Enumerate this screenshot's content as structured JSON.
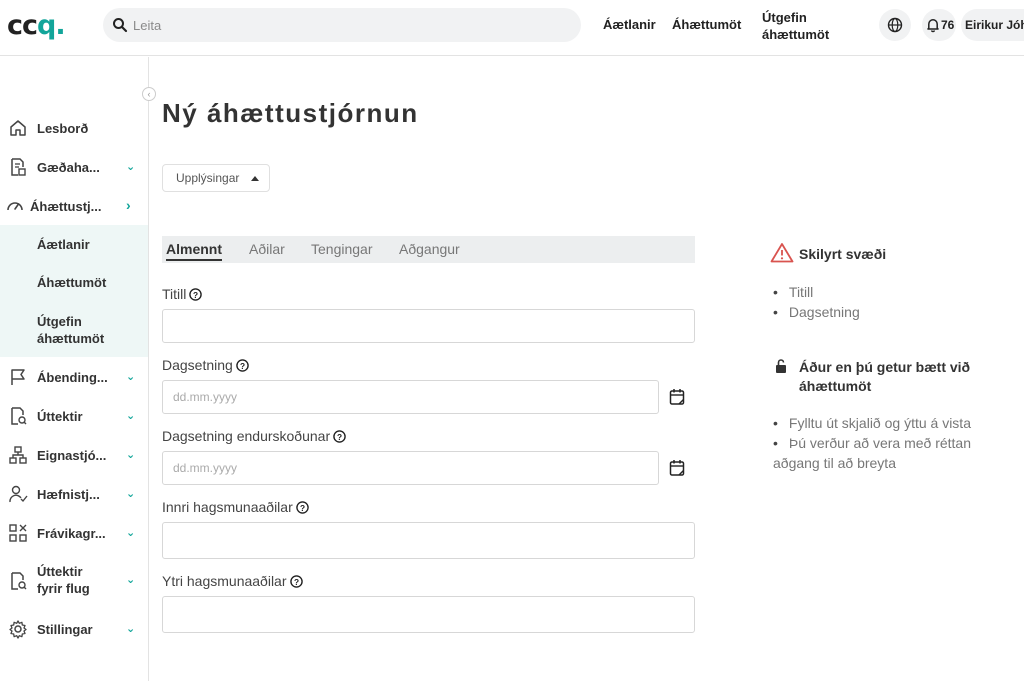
{
  "header": {
    "logo_main": "cc",
    "logo_accent": "q.",
    "search_placeholder": "Leita",
    "nav": [
      "Áætlanir",
      "Áhættumöt",
      "Útgefin áhættumöt"
    ],
    "notification_count": "76",
    "user_name": "Eirikur Jóh"
  },
  "sidebar": {
    "items": [
      {
        "label": "Lesborð",
        "icon": "home-icon"
      },
      {
        "label": "Gæðaha...",
        "icon": "document-check-icon"
      },
      {
        "label": "Áhættustj...",
        "icon": "gauge-icon"
      },
      {
        "label": "Ábending...",
        "icon": "flag-icon"
      },
      {
        "label": "Úttektir",
        "icon": "audit-icon"
      },
      {
        "label": "Eignastjó...",
        "icon": "hierarchy-icon"
      },
      {
        "label": "Hæfnistj...",
        "icon": "user-check-icon"
      },
      {
        "label": "Frávikagr...",
        "icon": "grid-x-icon"
      },
      {
        "label": "Úttektir fyrir flug",
        "icon": "flight-audit-icon"
      },
      {
        "label": "Stillingar",
        "icon": "gear-icon"
      }
    ],
    "sub_items": [
      "Áætlanir",
      "Áhættumöt",
      "Útgefin áhættumöt"
    ]
  },
  "main": {
    "title": "Ný áhættustjórnun",
    "info_button": "Upplýsingar",
    "tabs": [
      "Almennt",
      "Aðilar",
      "Tengingar",
      "Aðgangur"
    ],
    "fields": {
      "title_label": "Titill",
      "date_label": "Dagsetning",
      "date_placeholder": "dd.mm.yyyy",
      "review_date_label": "Dagsetning endurskoðunar",
      "review_date_placeholder": "dd.mm.yyyy",
      "internal_label": "Innri hagsmunaaðilar",
      "external_label": "Ytri hagsmunaaðilar"
    }
  },
  "right_panel": {
    "required_title": "Skilyrt svæði",
    "required_items": [
      "Titill",
      "Dagsetning"
    ],
    "before_title": "Áður en þú getur bætt við áhættumöt",
    "before_item_1": "Fylltu út skjalið og ýttu á vista",
    "before_item_2": "Þú verður að vera með réttan aðgang til að breyta"
  },
  "colors": {
    "accent": "#12a59a",
    "sidebar_active_bg": "#eef7f6",
    "warning": "#d9534f"
  }
}
